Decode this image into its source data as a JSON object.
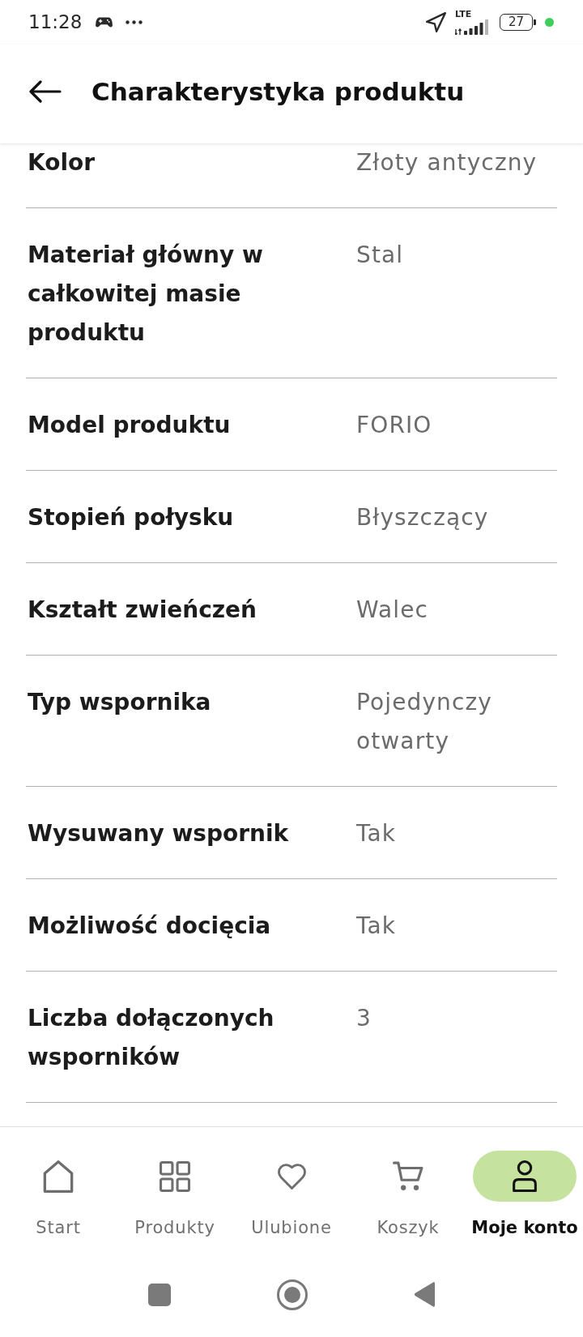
{
  "status_bar": {
    "time": "11:28",
    "network": "LTE",
    "battery": "27"
  },
  "header": {
    "title": "Charakterystyka produktu"
  },
  "attributes": [
    {
      "label": "Kolor",
      "value": "Złoty antyczny"
    },
    {
      "label": "Materiał główny w całkowitej masie produktu",
      "value": "Stal"
    },
    {
      "label": "Model produktu",
      "value": "FORIO"
    },
    {
      "label": "Stopień połysku",
      "value": "Błyszczący"
    },
    {
      "label": "Kształt zwieńczeń",
      "value": "Walec"
    },
    {
      "label": "Typ wspornika",
      "value": "Pojedynczy otwarty"
    },
    {
      "label": "Wysuwany wspornik",
      "value": "Tak"
    },
    {
      "label": "Możliwość docięcia",
      "value": "Tak"
    },
    {
      "label": "Liczba dołączonych wsporników",
      "value": "3"
    }
  ],
  "bottom_nav": [
    {
      "label": "Start",
      "selected": false
    },
    {
      "label": "Produkty",
      "selected": false
    },
    {
      "label": "Ulubione",
      "selected": false
    },
    {
      "label": "Koszyk",
      "selected": false
    },
    {
      "label": "Moje konto",
      "selected": true
    }
  ]
}
